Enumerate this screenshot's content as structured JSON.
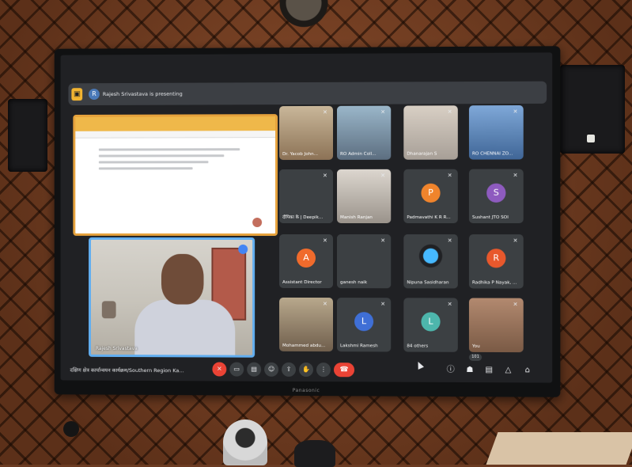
{
  "tv": {
    "brand": "Panasonic"
  },
  "meet": {
    "presenting_banner": "Rajesh Srivastava is presenting",
    "presenting_avatar_initial": "R",
    "presenter": {
      "name": "Rajesh Srivastava"
    },
    "meeting_title": "दक्षिण क्षेत्र कार्यान्वयन कार्यक्रम/Southern Region Ka...",
    "participant_count": "101",
    "tiles": [
      {
        "label": "Dr. Yacob John...",
        "initial": "",
        "color": "",
        "type": "photo"
      },
      {
        "label": "RO Admin Coll...",
        "initial": "",
        "color": "",
        "type": "photo"
      },
      {
        "label": "Dhanarajan S",
        "initial": "",
        "color": "",
        "type": "photo"
      },
      {
        "label": "RO CHENNAI ZO...",
        "initial": "",
        "color": "",
        "type": "photo"
      },
      {
        "label": "दीपिका के | Deepik...",
        "initial": "",
        "color": "",
        "type": "photo"
      },
      {
        "label": "Manish Ranjan",
        "initial": "",
        "color": "",
        "type": "photo"
      },
      {
        "label": "Padmavathi K R R...",
        "initial": "P",
        "color": "#f0842c",
        "type": "letter"
      },
      {
        "label": "Sushant JTO SOI",
        "initial": "S",
        "color": "#8e5bbf",
        "type": "letter"
      },
      {
        "label": "Assistant Director",
        "initial": "A",
        "color": "#f06b2c",
        "type": "letter"
      },
      {
        "label": "ganesh naik",
        "initial": "",
        "color": "",
        "type": "photo"
      },
      {
        "label": "Nipuna Sasidharan",
        "initial": "",
        "color": "",
        "type": "photo"
      },
      {
        "label": "Radhika P Nayak, ...",
        "initial": "R",
        "color": "#e8582c",
        "type": "letter"
      },
      {
        "label": "Mohammed abdu...",
        "initial": "",
        "color": "",
        "type": "photo"
      },
      {
        "label": "Lakshmi Ramesh",
        "initial": "L",
        "color": "#3f6fd6",
        "type": "letter"
      },
      {
        "label": "84 others",
        "initial": "",
        "color": "",
        "type": "others"
      },
      {
        "label": "You",
        "initial": "",
        "color": "",
        "type": "photo"
      }
    ],
    "controls": {
      "mic_icon": "mic-off-icon",
      "camera_icon": "camera-icon",
      "captions_icon": "captions-icon",
      "emoji_icon": "emoji-icon",
      "present_icon": "present-icon",
      "raise_hand_icon": "hand-icon",
      "more_icon": "more-vert-icon",
      "leave_icon": "call-end-icon"
    },
    "accent": "#4285f4",
    "danger": "#ea4335"
  }
}
